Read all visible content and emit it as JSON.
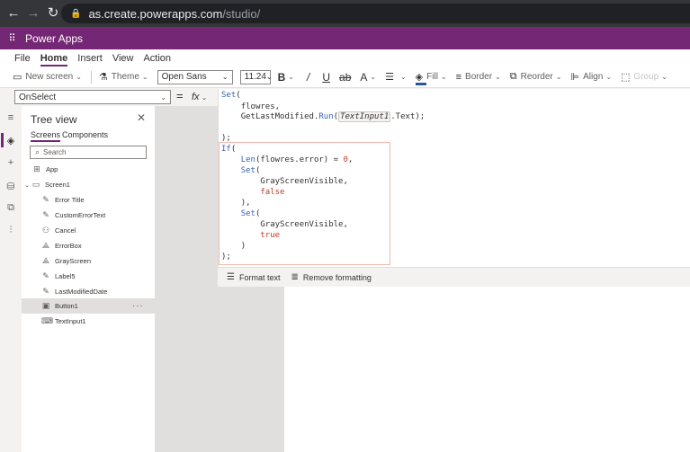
{
  "browser": {
    "url_host": "as.create.powerapps.com",
    "url_path": "/studio/"
  },
  "app": {
    "name": "Power Apps"
  },
  "menu_tabs": [
    "File",
    "Home",
    "Insert",
    "View",
    "Action"
  ],
  "ribbon": {
    "new_screen": "New screen",
    "theme": "Theme",
    "font": "Open Sans",
    "font_size": "11.24",
    "fill": "Fill",
    "border": "Border",
    "reorder": "Reorder",
    "align": "Align",
    "group": "Group"
  },
  "formula": {
    "property": "OnSelect",
    "equals": "=",
    "fx": "fx"
  },
  "tree": {
    "title": "Tree view",
    "tabs": [
      "Screens",
      "Components"
    ],
    "search_placeholder": "Search",
    "app_label": "App",
    "screen_label": "Screen1",
    "items": [
      "Error Title",
      "CustomErrorText",
      "Cancel",
      "ErrorBox",
      "GrayScreen",
      "Label5",
      "LastModifiedDate",
      "Button1",
      "TextInput1"
    ]
  },
  "code": {
    "set": "Set",
    "paren_open": "(",
    "paren_close": ")",
    "flowres": "flowres,",
    "getlast_pre": "GetLastModified.",
    "run": "Run",
    "textinput": "TextInput1",
    "getlast_post": ".Text);",
    "close_semi": ");",
    "if": "If",
    "len": "Len",
    "len_args": "(flowres.error) = ",
    "zero": "0",
    "comma": ",",
    "grayscreen": "GrayScreenVisible,",
    "false": "false",
    "close_comma": "),",
    "true": "true"
  },
  "format_strip": {
    "format_text": "Format text",
    "remove_formatting": "Remove formatting"
  }
}
